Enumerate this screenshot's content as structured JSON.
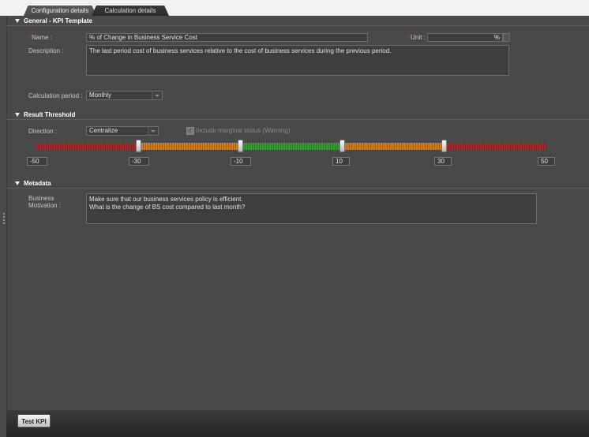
{
  "tabs": [
    {
      "label": "Configuration details",
      "active": true
    },
    {
      "label": "Calculation details",
      "active": false
    }
  ],
  "sections": {
    "general": {
      "title": "General - KPI Template",
      "name_label": "Name :",
      "name_value": "% of Change in Business Service Cost",
      "unit_label": "Unit :",
      "unit_value": "%",
      "description_label": "Description :",
      "description_value": "The last period cost of business services relative to the cost of business services during the previous period.",
      "calc_period_label": "Calculation period :",
      "calc_period_value": "Monthly"
    },
    "threshold": {
      "title": "Result Threshold",
      "direction_label": "Direction :",
      "direction_value": "Centralize",
      "marginal_label": "Include marginal status (Warning)",
      "marginal_checked": true,
      "ticks": [
        "-50",
        "-30",
        "-10",
        "10",
        "30",
        "50"
      ],
      "colors": {
        "red": "#a82a2a",
        "orange": "#d77b18",
        "green": "#2ea12e"
      }
    },
    "metadata": {
      "title": "Metadata",
      "business_label": "Business",
      "motivation_label": "Motivation :",
      "motivation_line1": "Make sure that our business services policy is efficient.",
      "motivation_line2": "What is the change of BS cost compared to last month?"
    }
  },
  "footer": {
    "test_button": "Test KPI"
  }
}
